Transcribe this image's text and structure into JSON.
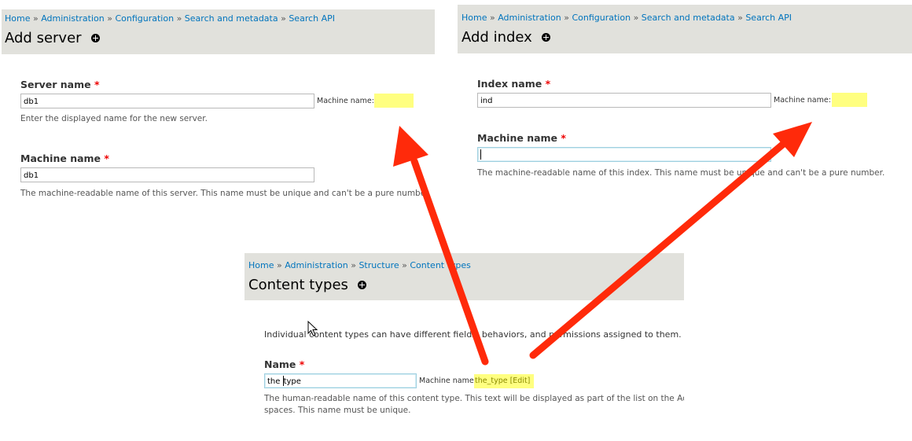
{
  "panel_server": {
    "breadcrumb": [
      "Home",
      "Administration",
      "Configuration",
      "Search and metadata",
      "Search API"
    ],
    "breadcrumb_sep": "»",
    "title": "Add server",
    "server_name_label": "Server name",
    "required_mark": "*",
    "server_name_value": "db1",
    "machine_name_label": "Machine name:",
    "server_name_desc": "Enter the displayed name for the new server.",
    "machine_label": "Machine name",
    "machine_value": "db1",
    "machine_desc": "The machine-readable name of this server. This name must be unique and can't be a pure number."
  },
  "panel_index": {
    "breadcrumb": [
      "Home",
      "Administration",
      "Configuration",
      "Search and metadata",
      "Search API"
    ],
    "breadcrumb_sep": "»",
    "title": "Add index",
    "index_name_label": "Index name",
    "required_mark": "*",
    "index_name_value": "ind",
    "machine_name_label": "Machine name:",
    "machine_label": "Machine name",
    "machine_value": "",
    "machine_desc": "The machine-readable name of this index. This name must be unique and can't be a pure number."
  },
  "panel_content": {
    "breadcrumb": [
      "Home",
      "Administration",
      "Structure",
      "Content types"
    ],
    "breadcrumb_sep": "»",
    "title": "Content types",
    "intro": "Individual content types can have different fields, behaviors, and permissions assigned to them.",
    "name_label": "Name",
    "required_mark": "*",
    "name_value_before_caret": "the ",
    "name_value_after_caret": "type",
    "machine_name_label": "Machine name:",
    "machine_name_value": "the_type [Edit]",
    "name_desc_line1": "The human-readable name of this content type. This text will be displayed as part of the list on the Ad",
    "name_desc_line2": "spaces. This name must be unique."
  },
  "annotation": {
    "arrow_color": "#ff2a0a"
  },
  "colors": {
    "header_bg": "#e1e1dc",
    "link": "#0074bd",
    "highlight": "#ffff80",
    "required": "#e00000"
  }
}
